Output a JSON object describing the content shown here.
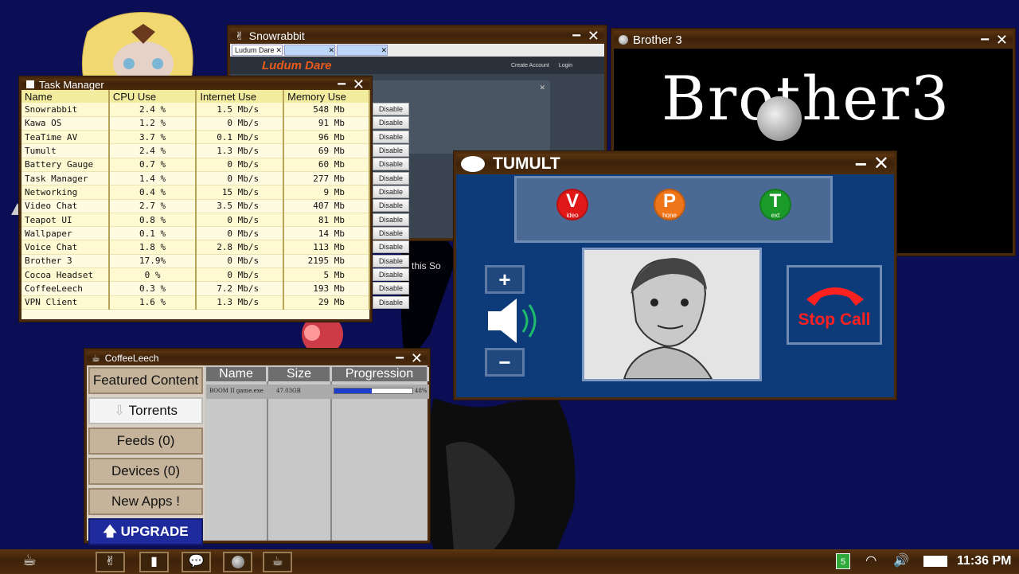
{
  "task_manager": {
    "title": "Task Manager",
    "columns": [
      "Name",
      "CPU Use",
      "Internet Use",
      "Memory Use"
    ],
    "disable_label": "Disable",
    "rows": [
      {
        "name": "Snowrabbit",
        "cpu": "2.4 %",
        "net": "1.5 Mb/s",
        "mem": "548 Mb"
      },
      {
        "name": "Kawa OS",
        "cpu": "1.2 %",
        "net": "0 Mb/s",
        "mem": "91 Mb"
      },
      {
        "name": "TeaTime AV",
        "cpu": "3.7 %",
        "net": "0.1 Mb/s",
        "mem": "96 Mb"
      },
      {
        "name": "Tumult",
        "cpu": "2.4 %",
        "net": "1.3 Mb/s",
        "mem": "69 Mb"
      },
      {
        "name": "Battery Gauge",
        "cpu": "0.7 %",
        "net": "0 Mb/s",
        "mem": "60 Mb"
      },
      {
        "name": "Task Manager",
        "cpu": "1.4 %",
        "net": "0 Mb/s",
        "mem": "277 Mb"
      },
      {
        "name": "Networking",
        "cpu": "0.4 %",
        "net": "15 Mb/s",
        "mem": "9 Mb"
      },
      {
        "name": "Video Chat",
        "cpu": "2.7 %",
        "net": "3.5 Mb/s",
        "mem": "407 Mb"
      },
      {
        "name": "Teapot UI",
        "cpu": "0.8 %",
        "net": "0 Mb/s",
        "mem": "81 Mb"
      },
      {
        "name": "Wallpaper",
        "cpu": "0.1 %",
        "net": "0 Mb/s",
        "mem": "14 Mb"
      },
      {
        "name": "Voice Chat",
        "cpu": "1.8 %",
        "net": "2.8 Mb/s",
        "mem": "113 Mb"
      },
      {
        "name": "Brother 3",
        "cpu": "17.9%",
        "net": "0 Mb/s",
        "mem": "2195 Mb"
      },
      {
        "name": "Cocoa Headset",
        "cpu": "0 %",
        "net": "0 Mb/s",
        "mem": "5 Mb"
      },
      {
        "name": "CoffeeLeech",
        "cpu": "0.3 %",
        "net": "7.2 Mb/s",
        "mem": "193 Mb"
      },
      {
        "name": "VPN Client",
        "cpu": "1.6 %",
        "net": "1.3 Mb/s",
        "mem": "29 Mb"
      }
    ]
  },
  "snowrabbit": {
    "title": "Snowrabbit",
    "tabs": [
      "Ludum Dare",
      "",
      ""
    ],
    "site_logo": "Ludum Dare",
    "create_account": "Create Account",
    "login": "Login",
    "peek_text": "this  So"
  },
  "brother3": {
    "title": "Brother 3",
    "logo_text": "Brother3"
  },
  "tumult": {
    "title": "TUMULT",
    "modes": [
      {
        "letter": "V",
        "sub": "ideo",
        "color": "#e01818"
      },
      {
        "letter": "P",
        "sub": "hone",
        "color": "#f07418"
      },
      {
        "letter": "T",
        "sub": "ext",
        "color": "#1a9a28"
      }
    ],
    "volume_up": "+",
    "volume_down": "−",
    "stop_call": "Stop Call"
  },
  "coffeeleech": {
    "title": "CoffeeLeech",
    "sidebar": {
      "featured": "Featured Content",
      "torrents": "Torrents",
      "feeds": "Feeds (0)",
      "devices": "Devices (0)",
      "new_apps": "New Apps !",
      "upgrade": "UPGRADE"
    },
    "columns": [
      "Name",
      "Size",
      "Progression"
    ],
    "downloads": [
      {
        "name": "BOOM II game.exe",
        "size": "47.03GB",
        "progress": 0.48,
        "progress_label": "48%"
      }
    ]
  },
  "taskbar": {
    "battery_level": "5",
    "time": "11:36 PM"
  },
  "colors": {
    "desktop": "#0b0d55",
    "wood": "#4a2a0c",
    "tumult_bg": "#0d3b7a",
    "stop_call": "#ff2020"
  }
}
